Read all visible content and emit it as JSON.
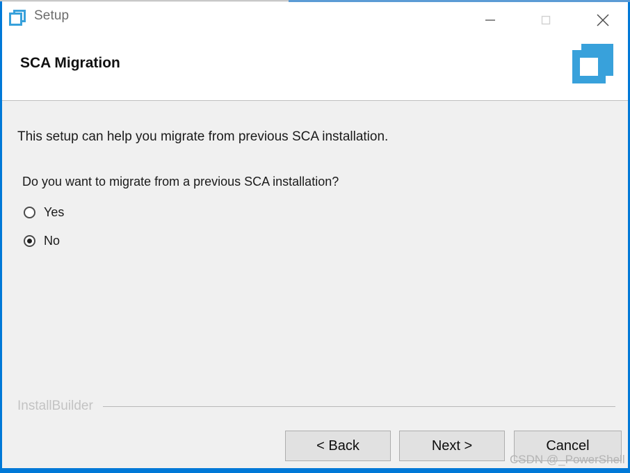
{
  "window": {
    "title": "Setup",
    "icon": "overlapping-squares-icon",
    "accent_color": "#38a1db",
    "border_color": "#0078d7",
    "controls": [
      {
        "name": "minimize",
        "glyph": "minimize-icon",
        "label": "Minimize"
      },
      {
        "name": "maximize",
        "glyph": "maximize-icon",
        "label": "Maximize"
      },
      {
        "name": "close",
        "glyph": "close-icon",
        "label": "Close"
      }
    ]
  },
  "header": {
    "title": "SCA Migration",
    "logo": "overlapping-squares-logo",
    "logo_color": "#38a1db"
  },
  "main": {
    "intro": "This setup can help you migrate from previous SCA installation.",
    "question": "Do you want to migrate from a previous SCA installation?",
    "options": [
      {
        "label": "Yes",
        "value": "yes",
        "selected": false
      },
      {
        "label": "No",
        "value": "no",
        "selected": true
      }
    ]
  },
  "footer": {
    "brand": "InstallBuilder",
    "buttons": [
      {
        "id": "back",
        "label": "< Back"
      },
      {
        "id": "next",
        "label": "Next >"
      },
      {
        "id": "cancel",
        "label": "Cancel"
      }
    ]
  },
  "watermark": {
    "text": "CSDN @_PowerShell"
  }
}
